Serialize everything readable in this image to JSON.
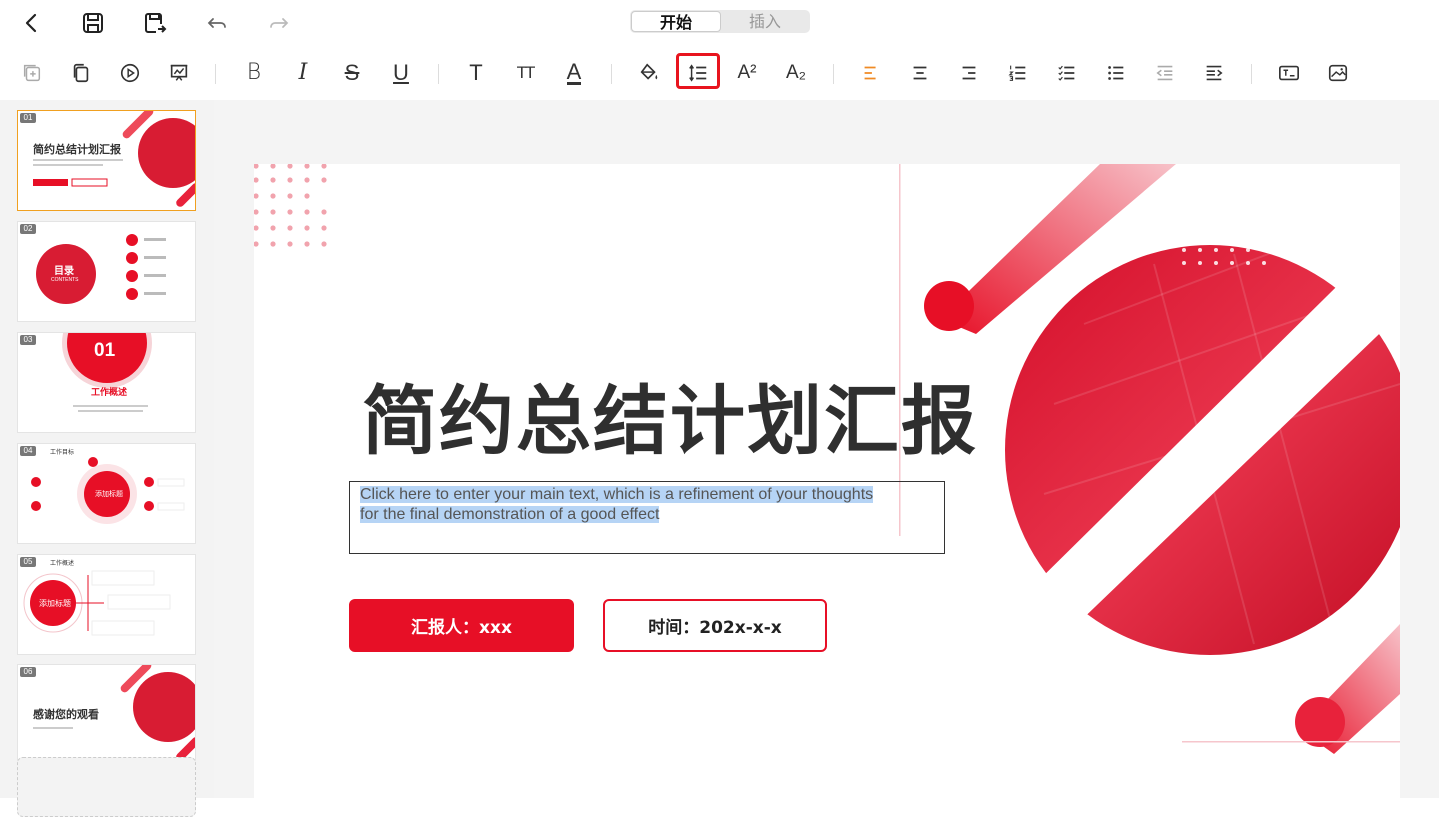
{
  "header": {
    "tabs": [
      {
        "label": "开始",
        "active": true
      },
      {
        "label": "插入",
        "active": false
      }
    ]
  },
  "icons": {
    "top": [
      "back-icon",
      "save-icon",
      "save-as-icon",
      "undo-icon",
      "redo-icon"
    ],
    "toolbar": [
      "new-slide-icon",
      "copy-icon",
      "play-icon",
      "present-icon",
      "bold-icon",
      "italic-icon",
      "strikethrough-icon",
      "underline-icon",
      "text-icon",
      "font-size-icon",
      "font-color-icon",
      "fill-bucket-icon",
      "line-spacing-icon",
      "superscript-icon",
      "subscript-icon",
      "align-left-icon",
      "align-center-icon",
      "align-right-icon",
      "numbered-list-icon",
      "checklist-icon",
      "bullet-list-icon",
      "outdent-icon",
      "indent-icon",
      "textbox-icon",
      "image-icon"
    ]
  },
  "toolbar": {
    "bold": "B",
    "italic": "I",
    "strike": "S",
    "underline": "U",
    "text": "T",
    "fontsize": "TT",
    "fontcolor": "A",
    "superscript": "A²",
    "subscript": "A₂"
  },
  "sidebar": {
    "slides": [
      {
        "num": "01",
        "title": "简约总结计划汇报"
      },
      {
        "num": "02",
        "title": "目录",
        "subtitle": "CONTENTS"
      },
      {
        "num": "03",
        "title": "工作概述",
        "badge": "01"
      },
      {
        "num": "04",
        "title": "工作目标",
        "center": "添加标题"
      },
      {
        "num": "05",
        "title": "工作概述",
        "center": "添加标题"
      },
      {
        "num": "06",
        "title": "感谢您的观看"
      }
    ]
  },
  "slide": {
    "title": "简约总结计划汇报",
    "body_line1": "Click here to enter your main text, which is a refinement of your thoughts",
    "body_line2": "for the final demonstration of a good effect",
    "reporter": "汇报人：xxx",
    "time": "时间：202x-x-x"
  },
  "colors": {
    "accent": "#e70f26",
    "highlight": "#e8141e",
    "selection": "#b6d4f5",
    "active_align": "#f08a24"
  }
}
